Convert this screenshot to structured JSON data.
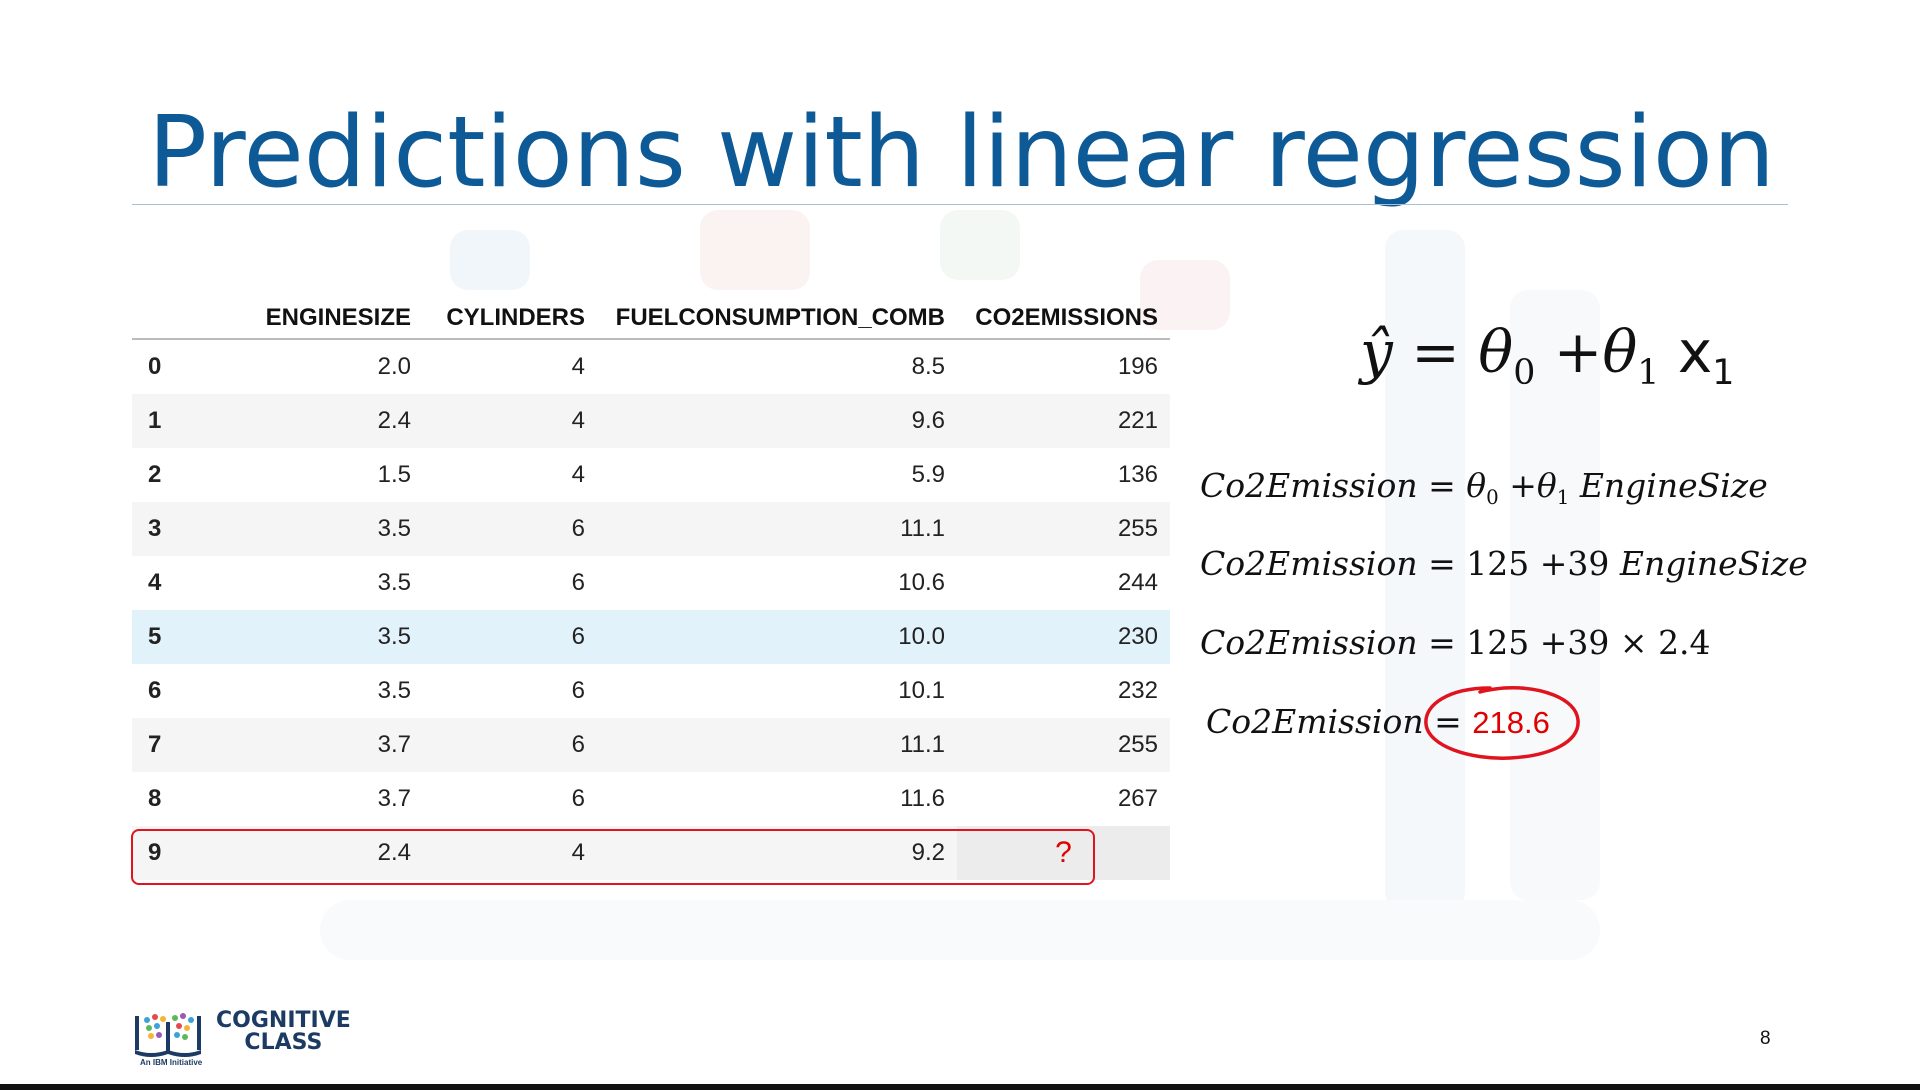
{
  "slide": {
    "title": "Predictions with linear regression",
    "page_number": "8"
  },
  "table": {
    "columns": [
      "",
      "ENGINESIZE",
      "CYLINDERS",
      "FUELCONSUMPTION_COMB",
      "CO2EMISSIONS"
    ],
    "rows": [
      [
        "0",
        "2.0",
        "4",
        "8.5",
        "196"
      ],
      [
        "1",
        "2.4",
        "4",
        "9.6",
        "221"
      ],
      [
        "2",
        "1.5",
        "4",
        "5.9",
        "136"
      ],
      [
        "3",
        "3.5",
        "6",
        "11.1",
        "255"
      ],
      [
        "4",
        "3.5",
        "6",
        "10.6",
        "244"
      ],
      [
        "5",
        "3.5",
        "6",
        "10.0",
        "230"
      ],
      [
        "6",
        "3.5",
        "6",
        "10.1",
        "232"
      ],
      [
        "7",
        "3.7",
        "6",
        "11.1",
        "255"
      ],
      [
        "8",
        "3.7",
        "6",
        "11.6",
        "267"
      ],
      [
        "9",
        "2.4",
        "4",
        "9.2",
        "?"
      ]
    ],
    "highlighted_row_index": 5,
    "circled_row_index": 9
  },
  "formulas": {
    "general": {
      "yhat": "ŷ",
      "eq": "=",
      "theta0": "θ",
      "sub0": "0",
      "plus": "+",
      "theta1": "θ",
      "sub1": "1",
      "x": "x",
      "subx": "1"
    },
    "line1": {
      "lhs": "Co2Emission",
      "eq": "=",
      "theta0": "θ",
      "sub0": "0",
      "plus": "+",
      "theta1": "θ",
      "sub1": "1",
      "var": "EngineSize"
    },
    "line2": {
      "lhs": "Co2Emission",
      "eq": "=",
      "c0": "125",
      "plus": "+",
      "c1": "39",
      "var": "EngineSize"
    },
    "line3": {
      "lhs": "Co2Emission",
      "eq": "=",
      "c0": "125",
      "plus": "+",
      "c1": "39",
      "times": "×",
      "val": "2.4"
    },
    "line4": {
      "lhs": "Co2Emission",
      "eq": "=",
      "result": "218.6"
    }
  },
  "logo": {
    "line1": "COGNITIVE",
    "line2": "CLASS",
    "tagline": "An IBM Initiative"
  },
  "colors": {
    "title": "#0d5a96",
    "highlight_red": "#e0141e",
    "row_highlight": "#e1f2fa"
  }
}
